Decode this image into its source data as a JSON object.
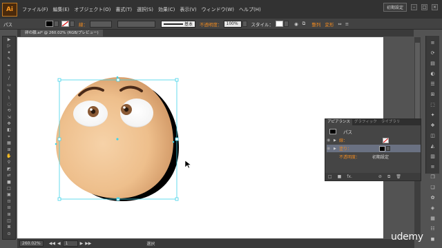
{
  "app": {
    "logo": "Ai",
    "workspace": "初期設定"
  },
  "menu": [
    "ファイル(F)",
    "編集(E)",
    "オブジェクト(O)",
    "書式(T)",
    "選択(S)",
    "効果(C)",
    "表示(V)",
    "ウィンドウ(W)",
    "ヘルプ(H)"
  ],
  "window_buttons": [
    "–",
    "□",
    "×"
  ],
  "controlbar": {
    "object_type": "パス",
    "stroke_label": "線：",
    "brush_label": "基本",
    "opacity_label": "不透明度：",
    "opacity_value": "100%",
    "style_label": "スタイル：",
    "align_label": "整列",
    "transform_label": "変形"
  },
  "document": {
    "tab": "卵の顔.ai* @ 260.02% (RGB/プレビュー)"
  },
  "tools": [
    "▶",
    "▷",
    "✦",
    "✎",
    "✒",
    "T",
    "/",
    "▭",
    "✎",
    "⌇",
    "◌",
    "⟲",
    "⇲",
    "✥",
    "◧",
    "⌖",
    "▦",
    "⊞",
    "✋",
    "⚲",
    "◩",
    "⇄",
    "■",
    "□",
    "▣",
    "⊡",
    "⊟",
    "⊞",
    "◫",
    "⊠",
    "⊙"
  ],
  "right_strip_icons": [
    "≡",
    "⟳",
    "▤",
    "◐",
    "☰",
    "⊞",
    "⬚",
    "✦",
    "❖",
    "◫",
    "◭",
    "▥",
    "≡",
    "❒",
    "❏",
    "✿",
    "◈",
    "▦",
    "☷",
    "◼"
  ],
  "appearance": {
    "tabs": [
      "アピアランス",
      "グラフィック",
      "ライブラリ"
    ],
    "object": "パス",
    "stroke_label": "線：",
    "fill_label": "塗り：",
    "opacity_label": "不透明度：",
    "opacity_value": "初期設定",
    "footer_icons": [
      "□",
      "■",
      "fx.",
      "⊘",
      "⧉",
      "🗑"
    ]
  },
  "statusbar": {
    "zoom": "260.02%",
    "artboard_nav": "1",
    "status": "選択"
  },
  "watermark": "udemy",
  "colors": {
    "accent_orange": "#ef8a21",
    "selection": "#3fd3e8",
    "egg_skin": "#f0c79a",
    "eye_iris": "#8a5a35"
  }
}
